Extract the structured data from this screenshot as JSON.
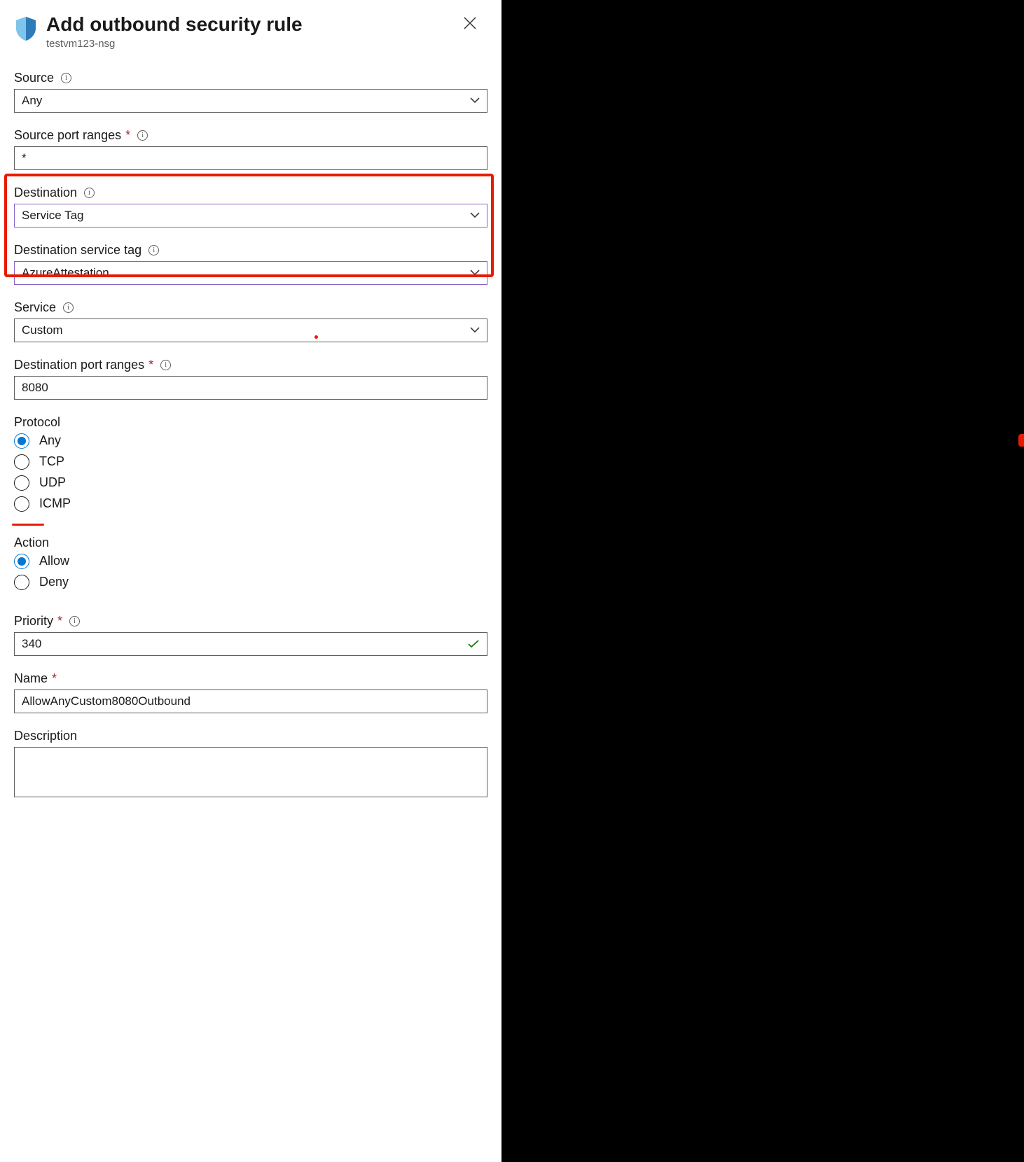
{
  "header": {
    "title": "Add outbound security rule",
    "subtitle": "testvm123-nsg"
  },
  "fields": {
    "source": {
      "label": "Source",
      "value": "Any"
    },
    "source_port_ranges": {
      "label": "Source port ranges",
      "value": "*"
    },
    "destination": {
      "label": "Destination",
      "value": "Service Tag"
    },
    "destination_service_tag": {
      "label": "Destination service tag",
      "value": "AzureAttestation"
    },
    "service": {
      "label": "Service",
      "value": "Custom"
    },
    "destination_port_ranges": {
      "label": "Destination port ranges",
      "value": "8080"
    },
    "protocol": {
      "label": "Protocol",
      "options": [
        "Any",
        "TCP",
        "UDP",
        "ICMP"
      ],
      "selected": "Any"
    },
    "action": {
      "label": "Action",
      "options": [
        "Allow",
        "Deny"
      ],
      "selected": "Allow"
    },
    "priority": {
      "label": "Priority",
      "value": "340"
    },
    "name": {
      "label": "Name",
      "value": "AllowAnyCustom8080Outbound"
    },
    "description": {
      "label": "Description",
      "value": ""
    }
  }
}
